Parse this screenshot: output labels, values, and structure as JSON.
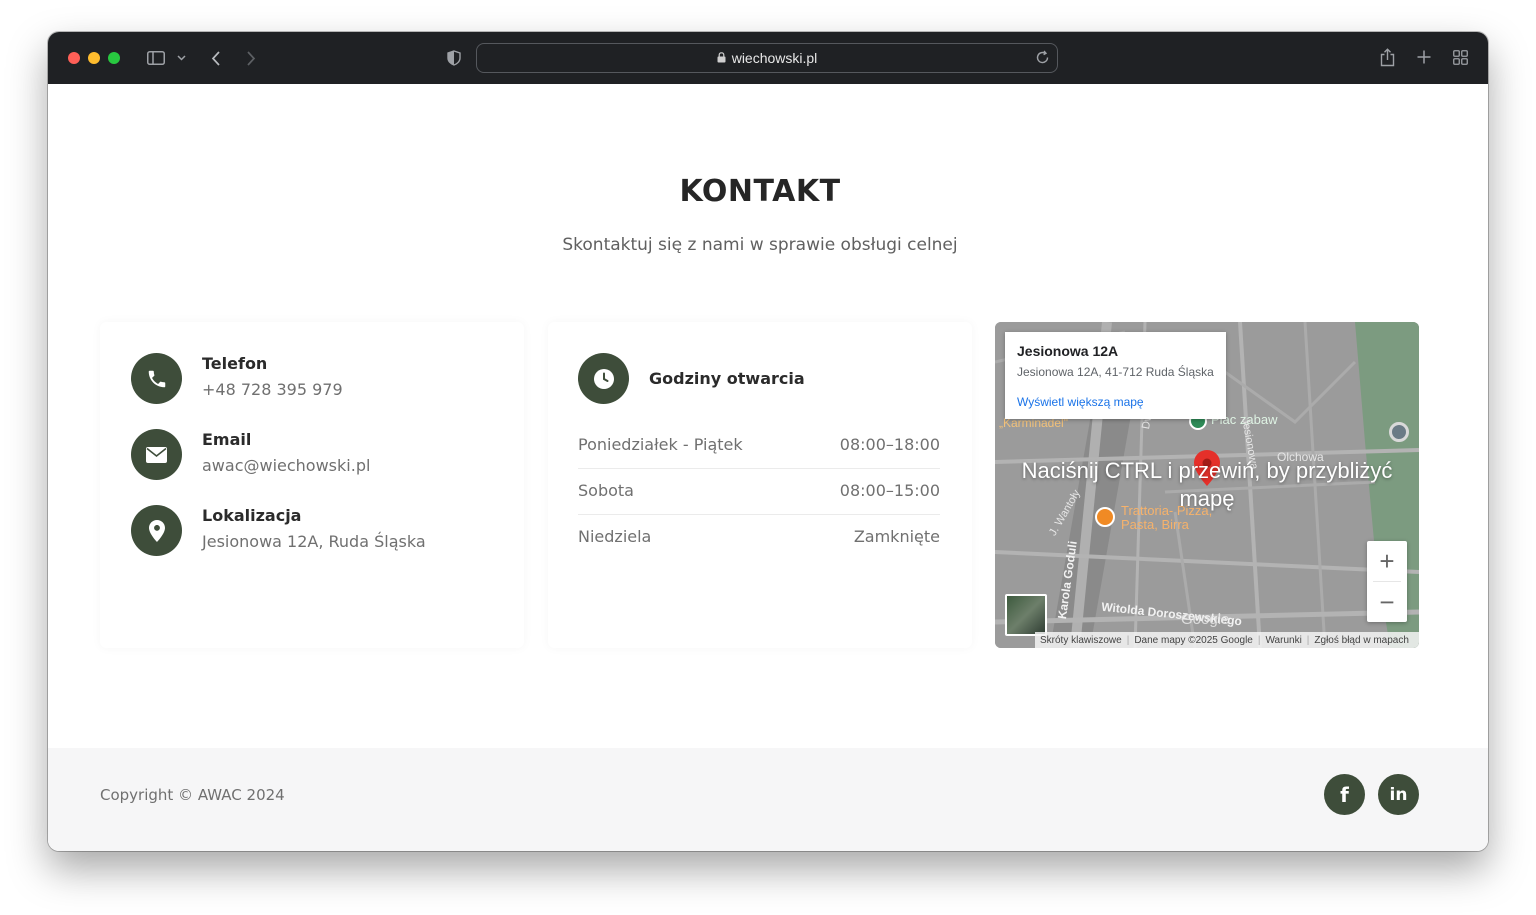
{
  "browser": {
    "url": "wiechowski.pl"
  },
  "page": {
    "title": "KONTAKT",
    "subtitle": "Skontaktuj się z nami w sprawie obsługi celnej"
  },
  "contact": {
    "phone": {
      "label": "Telefon",
      "value": "+48 728 395 979",
      "icon": "phone-icon"
    },
    "email": {
      "label": "Email",
      "value": "awac@wiechowski.pl",
      "icon": "envelope-icon"
    },
    "location": {
      "label": "Lokalizacja",
      "value": "Jesionowa 12A, Ruda Śląska",
      "icon": "map-pin-icon"
    }
  },
  "hours": {
    "title": "Godziny otwarcia",
    "rows": [
      {
        "day": "Poniedziałek - Piątek",
        "time": "08:00–18:00"
      },
      {
        "day": "Sobota",
        "time": "08:00–15:00"
      },
      {
        "day": "Niedziela",
        "time": "Zamknięte"
      }
    ]
  },
  "map": {
    "place_name": "Jesionowa 12A",
    "place_address": "Jesionowa 12A, 41-712 Ruda Śląska",
    "larger_map_link": "Wyświetl większą mapę",
    "overlay_text": "Naciśnij CTRL i przewiń, by przybliżyć mapę",
    "zoom_in": "+",
    "zoom_out": "−",
    "labels": {
      "plac_zabaw": "Plac zabaw",
      "karminadel": "„Karminadel\"",
      "olchowa": "Olchowa",
      "trattoria": "Trattoria- Pizza, Pasta, Birra",
      "karola_goduli": "Karola Goduli",
      "witolda": "Witolda Doroszewskiego",
      "j_wantoly": "J. Wantoły",
      "dwocow": "Dworcowa",
      "jesionowa_street": "Jesionowa",
      "google_logo": "Google"
    },
    "attribution": [
      "Skróty klawiszowe",
      "Dane mapy ©2025 Google",
      "Warunki",
      "Zgłoś błąd w mapach"
    ]
  },
  "footer": {
    "copyright": "Copyright © AWAC 2024",
    "social": [
      {
        "name": "facebook",
        "glyph": "f"
      },
      {
        "name": "linkedin",
        "glyph": "in"
      }
    ]
  },
  "colors": {
    "accent": "#3e4d3a",
    "map_background": "#9a9a9a",
    "map_link": "#1a73e8"
  }
}
